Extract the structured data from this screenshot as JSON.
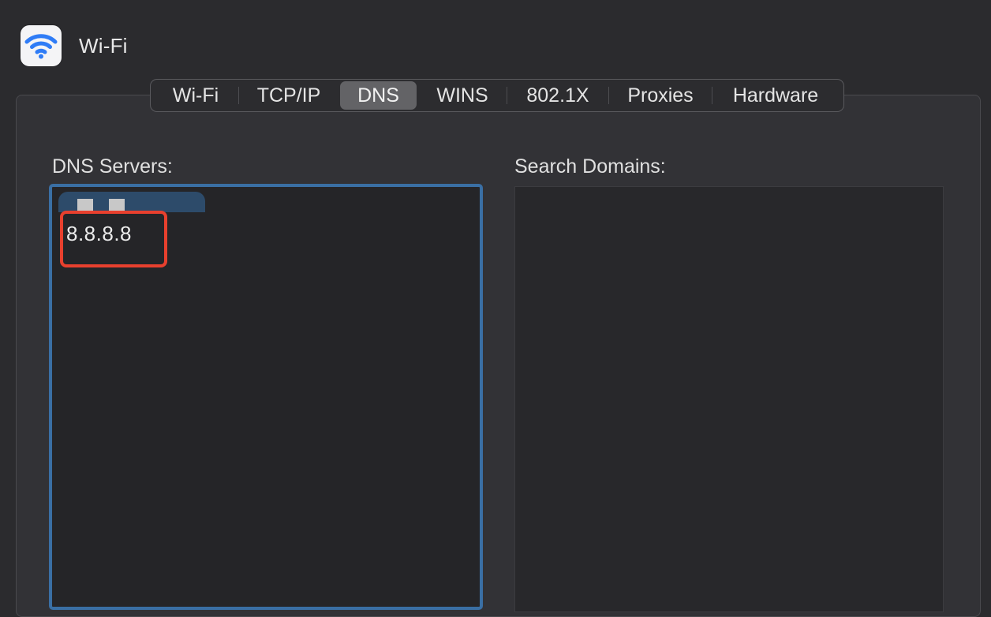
{
  "window": {
    "title": "Wi-Fi",
    "icon": "wifi-icon",
    "icon_color": "#2f7cf6"
  },
  "tabs": [
    {
      "label": "Wi-Fi",
      "active": false
    },
    {
      "label": "TCP/IP",
      "active": false
    },
    {
      "label": "DNS",
      "active": true
    },
    {
      "label": "WINS",
      "active": false
    },
    {
      "label": "802.1X",
      "active": false
    },
    {
      "label": "Proxies",
      "active": false
    },
    {
      "label": "Hardware",
      "active": false
    }
  ],
  "dns_servers": {
    "label": "DNS Servers:",
    "entries": [
      "8.8.8.8"
    ],
    "focus_color": "#3a6fa4",
    "highlight_color": "#e8402e"
  },
  "search_domains": {
    "label": "Search Domains:",
    "entries": []
  }
}
